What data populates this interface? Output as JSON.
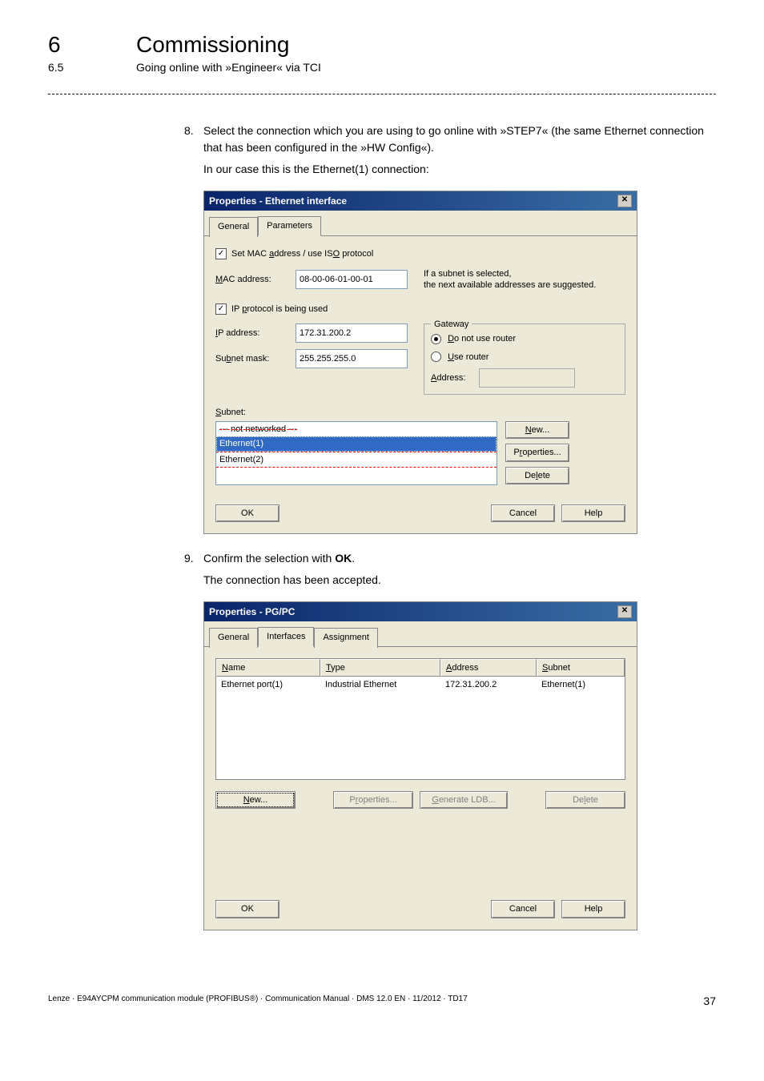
{
  "header": {
    "chapter_num": "6",
    "chapter_title": "Commissioning",
    "sub_num": "6.5",
    "sub_title": "Going online with »Engineer« via TCI"
  },
  "steps": {
    "s8": {
      "num": "8.",
      "text": "Select the connection which you are using to go online with »STEP7« (the same Ethernet connection that has been configured in the »HW Config«).",
      "result": "In our case this is the Ethernet(1) connection:"
    },
    "s9": {
      "num": "9.",
      "text_pre": "Confirm the selection with ",
      "text_bold": "OK",
      "text_post": ".",
      "result": "The connection has been accepted."
    }
  },
  "dialog1": {
    "title": "Properties - Ethernet interface",
    "tabs": {
      "general": "General",
      "parameters": "Parameters"
    },
    "chk_mac": "Set MAC address / use ISO protocol",
    "mac_label": "MAC address:",
    "mac_value": "08-00-06-01-00-01",
    "hint_l1": "If a subnet is selected,",
    "hint_l2": "the next available addresses are suggested.",
    "chk_ip": "IP protocol is being used",
    "ip_label": "IP address:",
    "ip_value": "172.31.200.2",
    "mask_label": "Subnet mask:",
    "mask_value": "255.255.255.0",
    "gateway": {
      "legend": "Gateway",
      "opt1": "Do not use router",
      "opt2": "Use router",
      "addr_label": "Address:"
    },
    "subnet_label": "Subnet:",
    "subnet_items": {
      "i0": "--- not networked ---",
      "i1": "Ethernet(1)",
      "i2": "Ethernet(2)"
    },
    "buttons": {
      "new": "New...",
      "props": "Properties...",
      "del": "Delete",
      "ok": "OK",
      "cancel": "Cancel",
      "help": "Help"
    }
  },
  "dialog2": {
    "title": "Properties - PG/PC",
    "tabs": {
      "general": "General",
      "interfaces": "Interfaces",
      "assignment": "Assignment"
    },
    "cols": {
      "name": "Name",
      "type": "Type",
      "address": "Address",
      "subnet": "Subnet"
    },
    "row": {
      "name": "Ethernet port(1)",
      "type": "Industrial Ethernet",
      "address": "172.31.200.2",
      "subnet": "Ethernet(1)"
    },
    "buttons": {
      "new": "New...",
      "props": "Properties...",
      "gen": "Generate LDB...",
      "del": "Delete",
      "ok": "OK",
      "cancel": "Cancel",
      "help": "Help"
    }
  },
  "footer": {
    "left": "Lenze · E94AYCPM communication module (PROFIBUS®) · Communication Manual · DMS 12.0 EN · 11/2012 · TD17",
    "right": "37"
  }
}
